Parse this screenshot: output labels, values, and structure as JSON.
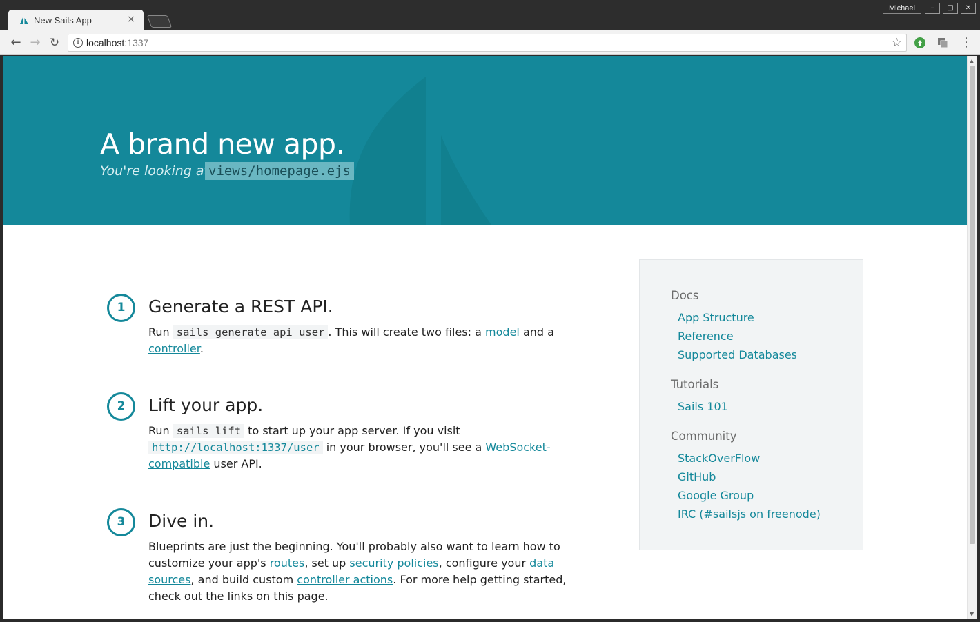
{
  "browser": {
    "tab_title": "New Sails App",
    "tab_close": "×",
    "user": "Michael",
    "window_min": "–",
    "window_max": "□",
    "window_close": "✕",
    "url_host": "localhost",
    "url_port": ":1337"
  },
  "hero": {
    "title": "A brand new app.",
    "subtitle": "You're looking at:",
    "file": "views/homepage.ejs"
  },
  "steps": [
    {
      "number": "1",
      "title": "Generate a REST API.",
      "body": {
        "t1": "Run ",
        "code": "sails generate api user",
        "t2": ". This will create two files: a ",
        "link1": "model",
        "t3": " and a ",
        "link2": "controller",
        "t4": "."
      }
    },
    {
      "number": "2",
      "title": "Lift your app.",
      "body": {
        "t1": "Run ",
        "code": "sails lift",
        "t2": " to start up your app server. If you visit ",
        "code_link": "http://localhost:1337/user",
        "t3": " in your browser, you'll see a ",
        "link1": "WebSocket-compatible",
        "t4": " user API."
      }
    },
    {
      "number": "3",
      "title": "Dive in.",
      "body": {
        "t1": "Blueprints are just the beginning. You'll probably also want to learn how to customize your app's ",
        "link1": "routes",
        "t2": ", set up ",
        "link2": "security policies",
        "t3": ", configure your ",
        "link3": "data sources",
        "t4": ", and build custom ",
        "link4": "controller actions",
        "t5": ". For more help getting started, check out the links on this page."
      }
    }
  ],
  "sidebar": {
    "docs_heading": "Docs",
    "docs": [
      "App Structure",
      "Reference",
      "Supported Databases"
    ],
    "tutorials_heading": "Tutorials",
    "tutorials": [
      "Sails 101"
    ],
    "community_heading": "Community",
    "community": [
      "StackOverFlow",
      "GitHub",
      "Google Group",
      "IRC (#sailsjs on freenode)"
    ]
  },
  "colors": {
    "brand": "#14889a",
    "hero_bg": "#14889a",
    "sidebar_bg": "#f2f4f5"
  }
}
